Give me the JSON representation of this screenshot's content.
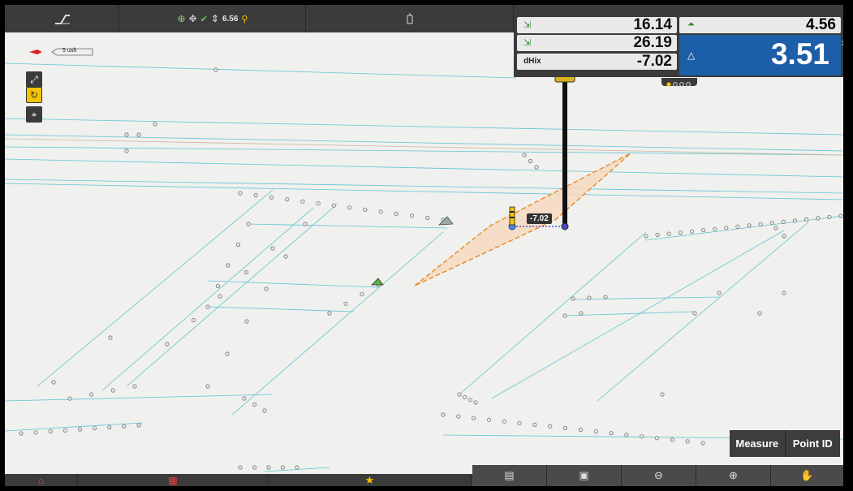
{
  "topbar": {
    "gps_height": "6.56"
  },
  "scale": {
    "label": "5 usft"
  },
  "readout": {
    "northing_delta": "16.14",
    "easting_delta": "26.19",
    "dhix_label": "dHix",
    "dhix_value": "-7.02",
    "elev_small": "4.56",
    "elev_big": "3.51"
  },
  "map": {
    "target_label": "-7.02"
  },
  "actions": {
    "measure_label": "Measure",
    "point_id_label": "Point ID"
  },
  "icons": {
    "accent": "#f4c400",
    "blue_panel": "#1d5ea9",
    "polygon_fill": "#f6d9bf",
    "polygon_stroke": "#e98a25"
  }
}
